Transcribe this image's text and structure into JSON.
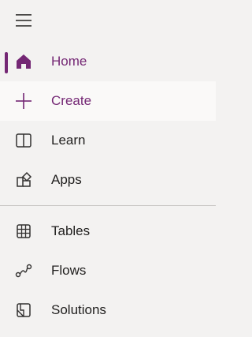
{
  "nav": {
    "menu_icon": "hamburger-menu-icon",
    "accent_color": "#742774",
    "items_primary": [
      {
        "label": "Home",
        "icon": "home-icon",
        "selected": true
      },
      {
        "label": "Create",
        "icon": "plus-icon",
        "hovered": true
      },
      {
        "label": "Learn",
        "icon": "book-icon"
      },
      {
        "label": "Apps",
        "icon": "apps-icon"
      }
    ],
    "items_secondary": [
      {
        "label": "Tables",
        "icon": "table-grid-icon"
      },
      {
        "label": "Flows",
        "icon": "flow-icon"
      },
      {
        "label": "Solutions",
        "icon": "solutions-icon"
      }
    ]
  }
}
